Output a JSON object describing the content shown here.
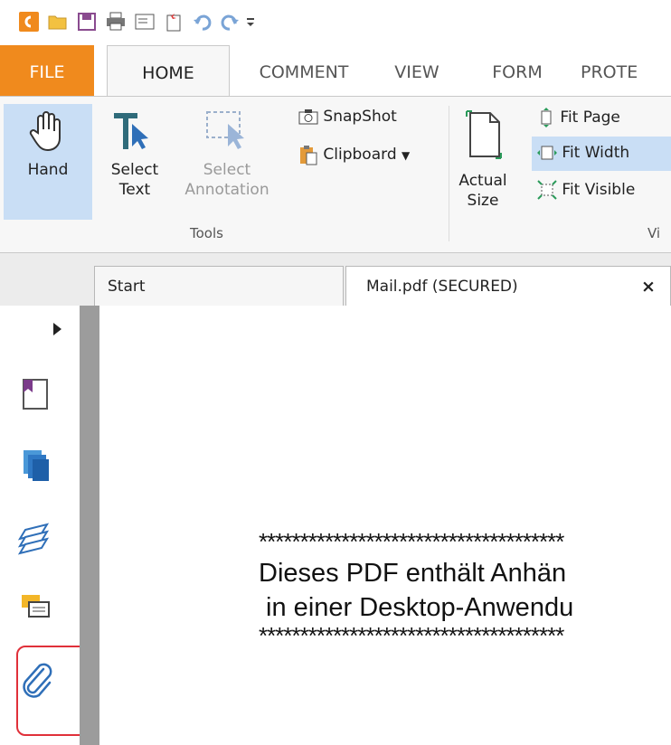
{
  "quick_access": {
    "icons": [
      "app-logo-icon",
      "open-folder-icon",
      "save-icon",
      "print-icon",
      "document-properties-icon",
      "new-document-icon",
      "undo-icon",
      "redo-icon",
      "customize-dropdown-icon"
    ]
  },
  "ribbon_tabs": [
    {
      "label": "FILE"
    },
    {
      "label": "HOME"
    },
    {
      "label": "COMMENT"
    },
    {
      "label": "VIEW"
    },
    {
      "label": "FORM"
    },
    {
      "label": "PROTE"
    }
  ],
  "ribbon": {
    "hand": {
      "label": "Hand"
    },
    "select_text": {
      "line1": "Select",
      "line2": "Text"
    },
    "select_annotation": {
      "line1": "Select",
      "line2": "Annotation"
    },
    "snapshot": {
      "label": "SnapShot"
    },
    "clipboard": {
      "label": "Clipboard"
    },
    "tools_group": "Tools",
    "actual_size": {
      "line1": "Actual",
      "line2": "Size"
    },
    "fit_page": {
      "label": "Fit Page"
    },
    "fit_width": {
      "label": "Fit Width"
    },
    "fit_visible": {
      "label": "Fit Visible"
    },
    "view_group": "Vi"
  },
  "doc_tabs": [
    {
      "label": "Start"
    },
    {
      "label": "Mail.pdf (SECURED)",
      "close": "×"
    }
  ],
  "nav_panel": {
    "icons": [
      "expand-arrow-icon",
      "bookmark-icon",
      "pages-icon",
      "layers-icon",
      "comments-icon",
      "attachments-icon"
    ]
  },
  "document": {
    "stars_line": "*************************************",
    "line1": "Dieses PDF enthält Anhän",
    "line2": " in einer Desktop-Anwendu",
    "stars_line2": "*************************************"
  },
  "colors": {
    "file_tab": "#f08a1d",
    "selected_button": "#c9def5",
    "highlight_border": "#e0303a",
    "nav_divider": "#9c9c9c"
  }
}
